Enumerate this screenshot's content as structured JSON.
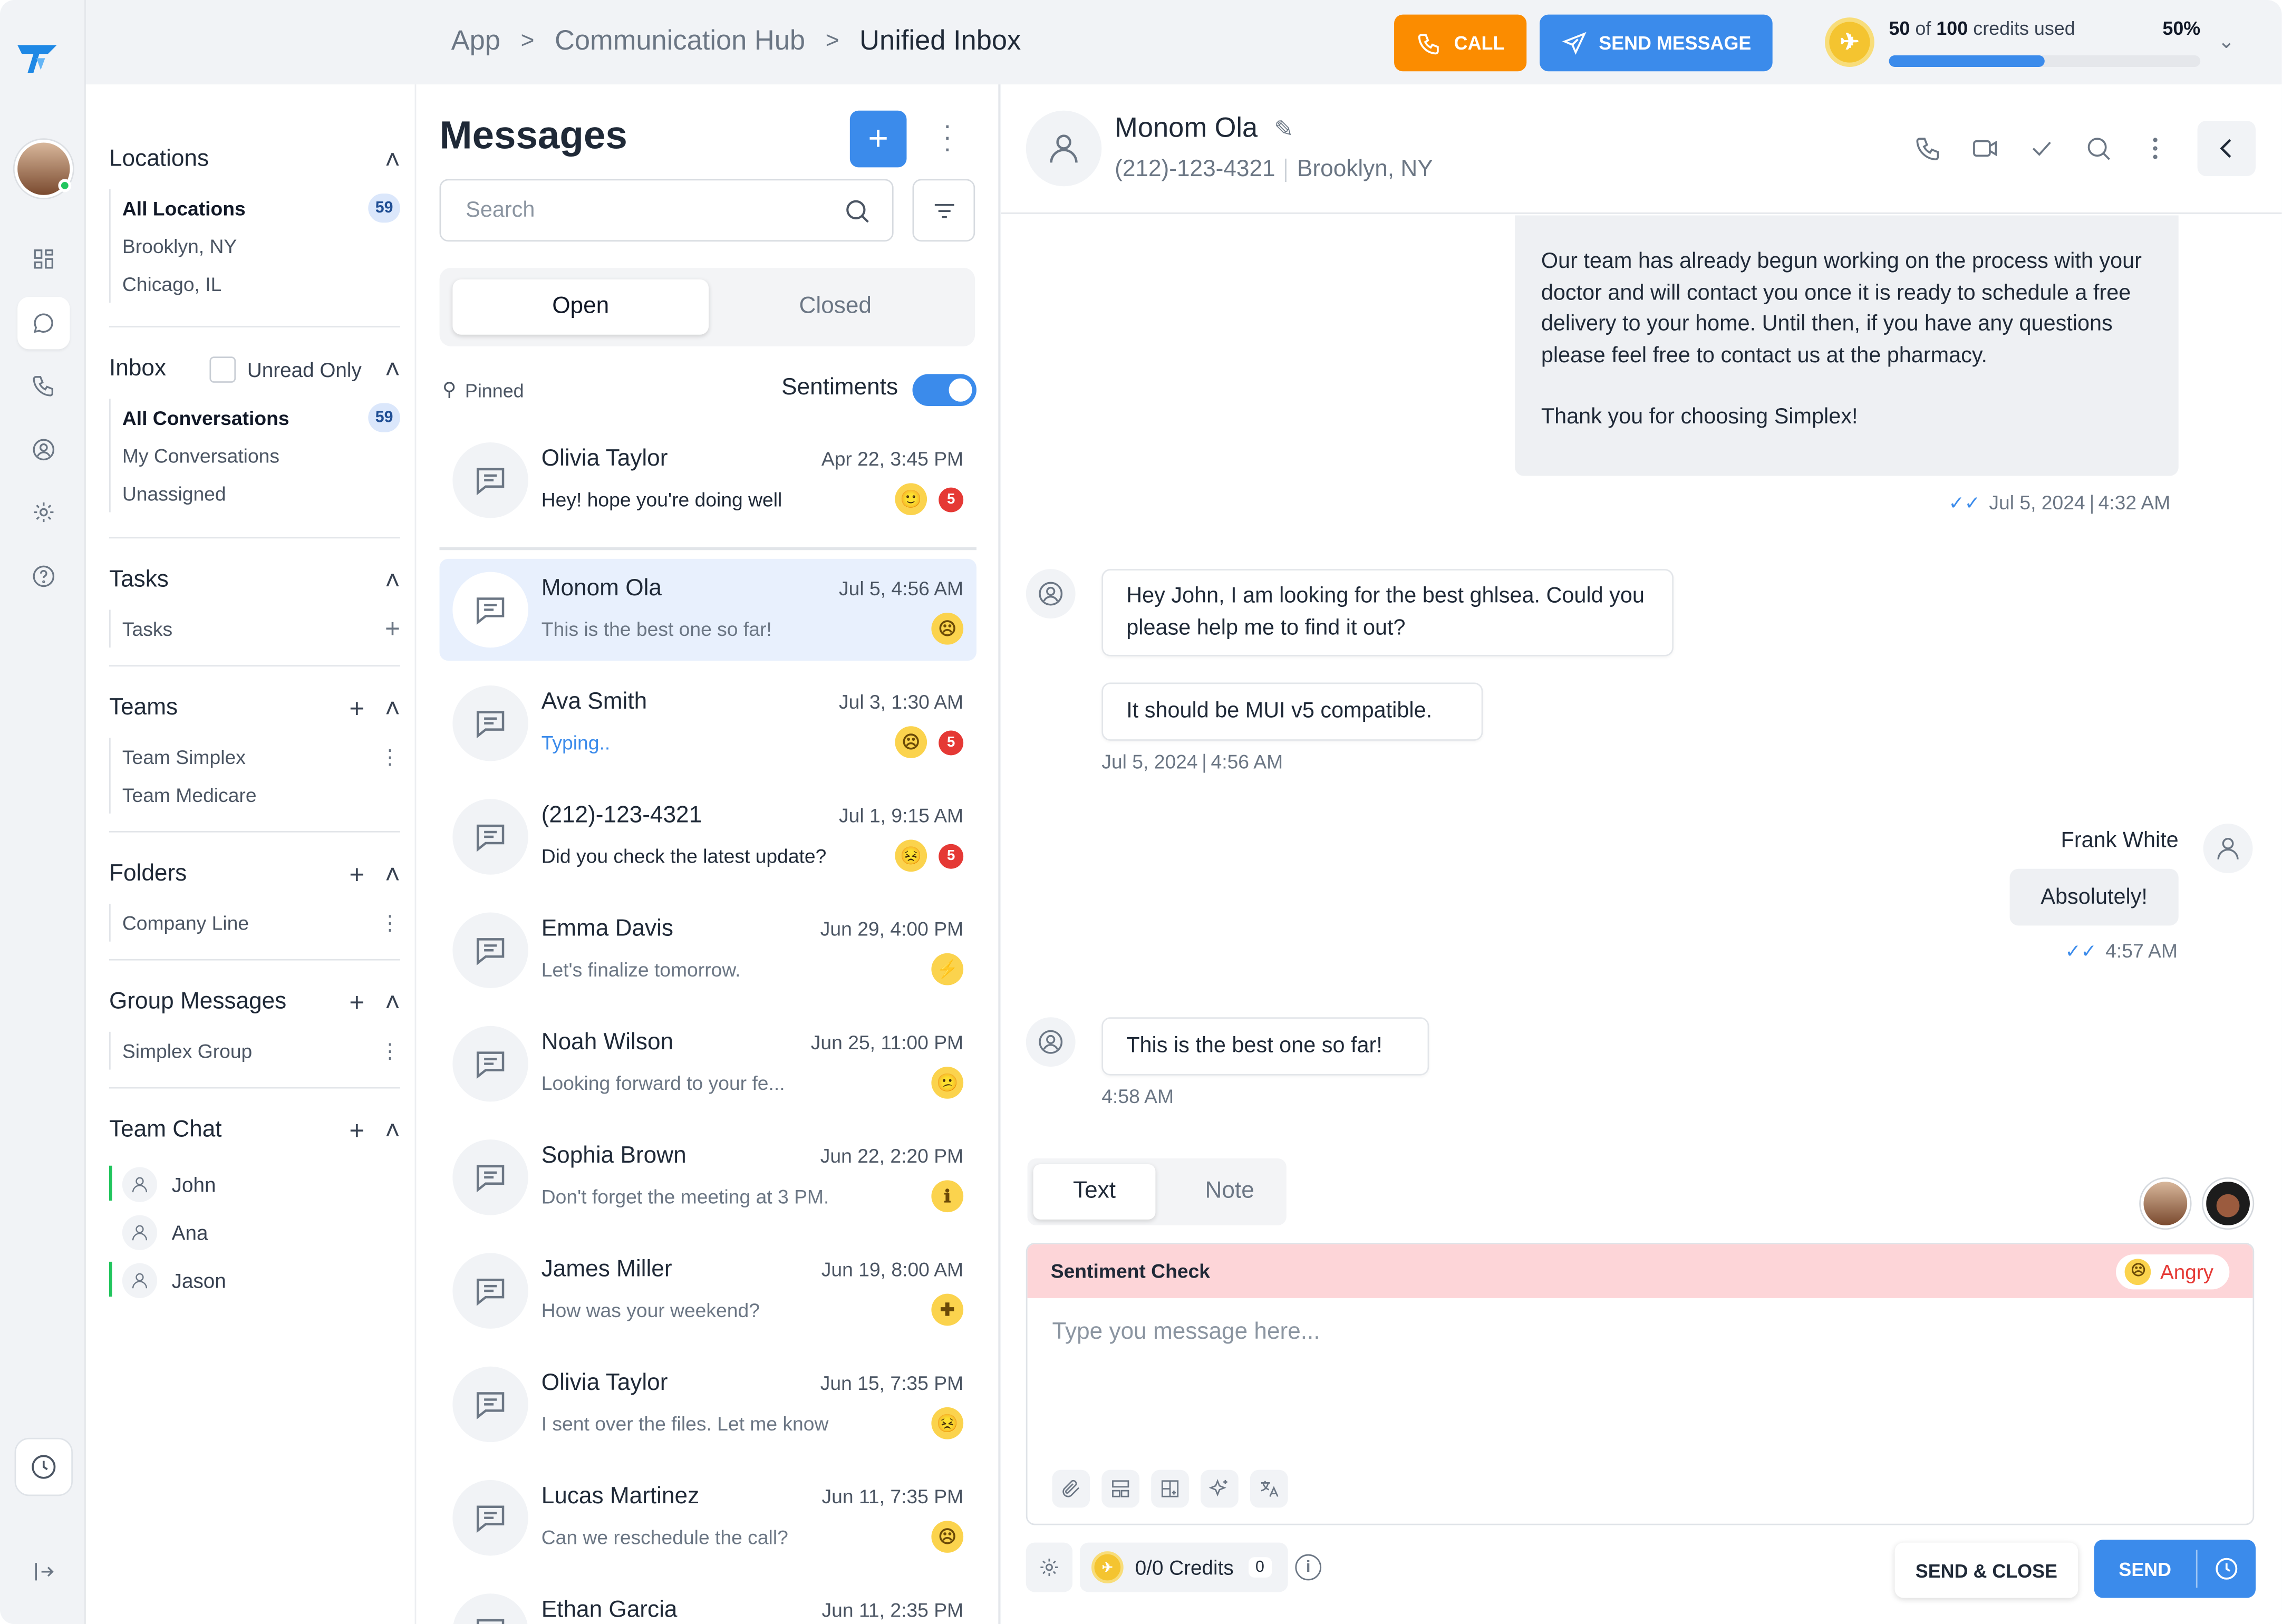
{
  "breadcrumb": {
    "items": [
      "App",
      "Communication Hub",
      "Unified Inbox"
    ],
    "separator": ">"
  },
  "topbar": {
    "call_label": "CALL",
    "send_message_label": "SEND MESSAGE",
    "credits": {
      "used": "50",
      "of": "of",
      "total": "100",
      "suffix": "credits used",
      "percent_label": "50%",
      "percent": 50
    }
  },
  "nav": {
    "locations": {
      "title": "Locations",
      "items": [
        {
          "label": "All Locations",
          "count": "59"
        },
        {
          "label": "Brooklyn, NY"
        },
        {
          "label": "Chicago, IL"
        }
      ]
    },
    "inbox": {
      "title": "Inbox",
      "unread_label": "Unread Only",
      "items": [
        {
          "label": "All Conversations",
          "count": "59"
        },
        {
          "label": "My Conversations"
        },
        {
          "label": "Unassigned"
        }
      ]
    },
    "tasks": {
      "title": "Tasks",
      "items": [
        {
          "label": "Tasks"
        }
      ]
    },
    "teams": {
      "title": "Teams",
      "items": [
        {
          "label": "Team Simplex"
        },
        {
          "label": "Team Medicare"
        }
      ]
    },
    "folders": {
      "title": "Folders",
      "items": [
        {
          "label": "Company Line"
        }
      ]
    },
    "groups": {
      "title": "Group Messages",
      "items": [
        {
          "label": "Simplex Group"
        }
      ]
    },
    "team_chat": {
      "title": "Team Chat",
      "items": [
        {
          "label": "John"
        },
        {
          "label": "Ana"
        },
        {
          "label": "Jason"
        }
      ]
    }
  },
  "messages": {
    "title": "Messages",
    "search_placeholder": "Search",
    "tabs": [
      "Open",
      "Closed"
    ],
    "pinned_label": "Pinned",
    "sentiments_label": "Sentiments",
    "conversations": [
      {
        "name": "Olivia Taylor",
        "date": "Apr 22, 3:45 PM",
        "preview": "Hey! hope you're doing well",
        "emoji": "🙂",
        "unread": "5"
      },
      {
        "name": "Monom Ola",
        "date": "Jul 5, 4:56 AM",
        "preview": "This is the best one so far!",
        "emoji": "☹"
      },
      {
        "name": "Ava Smith",
        "date": "Jul 3, 1:30 AM",
        "preview": "Typing..",
        "emoji": "☹",
        "unread": "5"
      },
      {
        "name": "(212)-123-4321",
        "date": "Jul 1, 9:15 AM",
        "preview": "Did you check the latest update?",
        "emoji": "😣",
        "unread": "5"
      },
      {
        "name": "Emma Davis",
        "date": "Jun 29, 4:00 PM",
        "preview": "Let's finalize tomorrow.",
        "emoji": "⚡"
      },
      {
        "name": "Noah Wilson",
        "date": "Jun 25, 11:00 PM",
        "preview": "Looking forward to your fe...",
        "emoji": "😕"
      },
      {
        "name": "Sophia Brown",
        "date": "Jun 22, 2:20 PM",
        "preview": "Don't forget the meeting at 3 PM.",
        "emoji": "ℹ"
      },
      {
        "name": "James Miller",
        "date": "Jun 19, 8:00 AM",
        "preview": "How was your weekend?",
        "emoji": "✚"
      },
      {
        "name": "Olivia Taylor",
        "date": "Jun 15, 7:35 PM",
        "preview": "I sent over the files. Let me know",
        "emoji": "😣"
      },
      {
        "name": "Lucas Martinez",
        "date": "Jun 11, 7:35 PM",
        "preview": "Can we reschedule the call?",
        "emoji": "☹"
      },
      {
        "name": "Ethan Garcia",
        "date": "Jun 11, 2:35 PM",
        "preview": ""
      }
    ]
  },
  "chat": {
    "contact_name": "Monom Ola",
    "phone": "(212)-123-4321",
    "location": "Brooklyn, NY",
    "msg1_text": "Our team has already begun working on the process with your doctor and will contact you once it is ready to schedule a free delivery to your home. Until then, if you have any questions please feel free to contact us at the pharmacy.",
    "msg1_thanks": "Thank you for choosing Simplex!",
    "msg1_date": "Jul 5, 2024",
    "msg1_time": "4:32 AM",
    "msg2_text": "Hey John, I am looking for the best ghlsea. Could you please help me to find it out?",
    "msg3_text": "It should be MUI v5 compatible.",
    "msg3_date": "Jul 5, 2024",
    "msg3_time": "4:56 AM",
    "msg4_sender": "Frank White",
    "msg4_text": "Absolutely!",
    "msg4_time": "4:57 AM",
    "msg5_text": "This is the best one so far!",
    "msg5_time": "4:58 AM"
  },
  "composer": {
    "tabs": [
      "Text",
      "Note"
    ],
    "sentiment_title": "Sentiment Check",
    "sentiment_value": "Angry",
    "placeholder": "Type you message here...",
    "credits_label": "0/0 Credits",
    "credits_count": "0",
    "send_close_label": "SEND & CLOSE",
    "send_label": "SEND"
  },
  "colors": {
    "accent": "#3b8beb",
    "call": "#fb8c00",
    "angry": "#e53935",
    "sentiment_bg": "#fdd5d8"
  }
}
